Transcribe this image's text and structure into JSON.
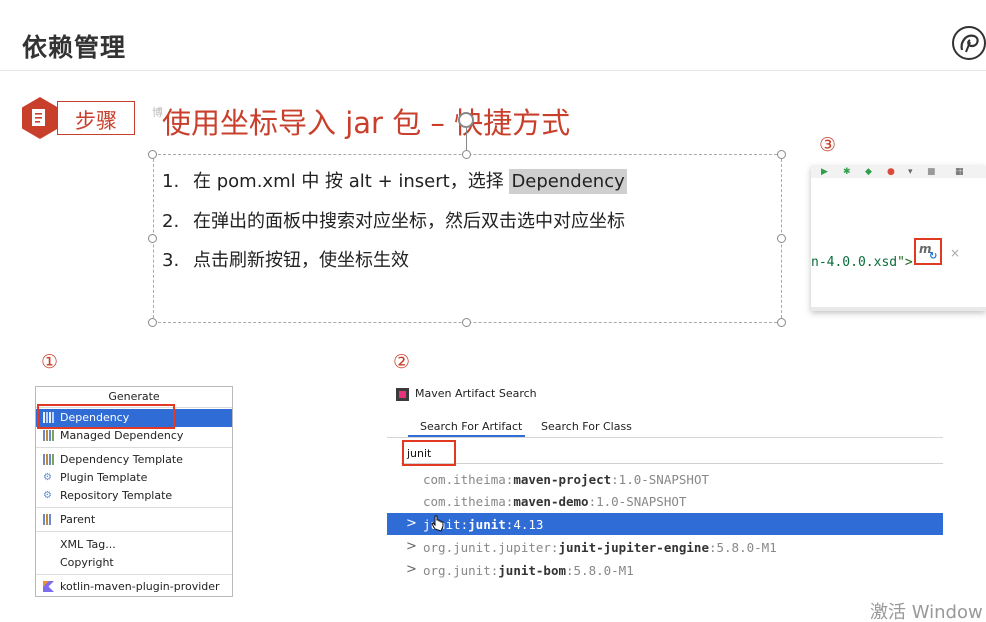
{
  "header": {
    "title": "依赖管理",
    "logo_icon": "swirl-logo-icon"
  },
  "step": {
    "label": "步骤",
    "ghost_text": "博",
    "heading": "使用坐标导入 jar 包 – 快捷方式"
  },
  "steps": [
    {
      "num": "1.",
      "text_before": "在 pom.xml 中 按 alt + insert，选择 ",
      "highlight": "Dependency"
    },
    {
      "num": "2.",
      "text": "在弹出的面板中搜索对应坐标，然后双击选中对应坐标"
    },
    {
      "num": "3.",
      "text": "点击刷新按钮，使坐标生效"
    }
  ],
  "markers": {
    "one": "①",
    "two": "②",
    "three": "③"
  },
  "shot3": {
    "code_text": "n-4.0.0.xsd",
    "code_tail": "\">",
    "maven_icon": "m",
    "refresh_icon": "↻",
    "close_icon": "×"
  },
  "generate_menu": {
    "title": "Generate",
    "items": [
      {
        "label": "Dependency",
        "icon": "bars-icon",
        "selected": true
      },
      {
        "label": "Managed Dependency",
        "icon": "bars-icon"
      },
      {
        "label": "Dependency Template",
        "icon": "bars-icon"
      },
      {
        "label": "Plugin Template",
        "icon": "plugin-icon"
      },
      {
        "label": "Repository Template",
        "icon": "repository-icon"
      },
      {
        "label": "Parent",
        "icon": "parent-icon"
      },
      {
        "label": "XML Tag...",
        "icon": ""
      },
      {
        "label": "Copyright",
        "icon": ""
      },
      {
        "label": "kotlin-maven-plugin-provider",
        "icon": "kotlin-icon"
      }
    ]
  },
  "maven_search": {
    "title": "Maven Artifact Search",
    "tabs": [
      "Search For Artifact",
      "Search For Class"
    ],
    "query": "junit",
    "results": [
      {
        "chevron": "",
        "group": "com.itheima:",
        "artifact": "maven-project",
        "version": ":1.0-SNAPSHOT"
      },
      {
        "chevron": "",
        "group": "com.itheima:",
        "artifact": "maven-demo",
        "version": ":1.0-SNAPSHOT"
      },
      {
        "chevron": ">",
        "group": "junit:",
        "artifact": "junit",
        "version": ":4.13",
        "selected": true
      },
      {
        "chevron": ">",
        "group": "org.junit.jupiter:",
        "artifact": "junit-jupiter-engine",
        "version": ":5.8.0-M1"
      },
      {
        "chevron": ">",
        "group": "org.junit:",
        "artifact": "junit-bom",
        "version": ":5.8.0-M1"
      }
    ]
  },
  "watermark": "激活 Window",
  "colors": {
    "accent": "#c8402c",
    "selection": "#2f6cd6",
    "frame": "#e23a22"
  }
}
